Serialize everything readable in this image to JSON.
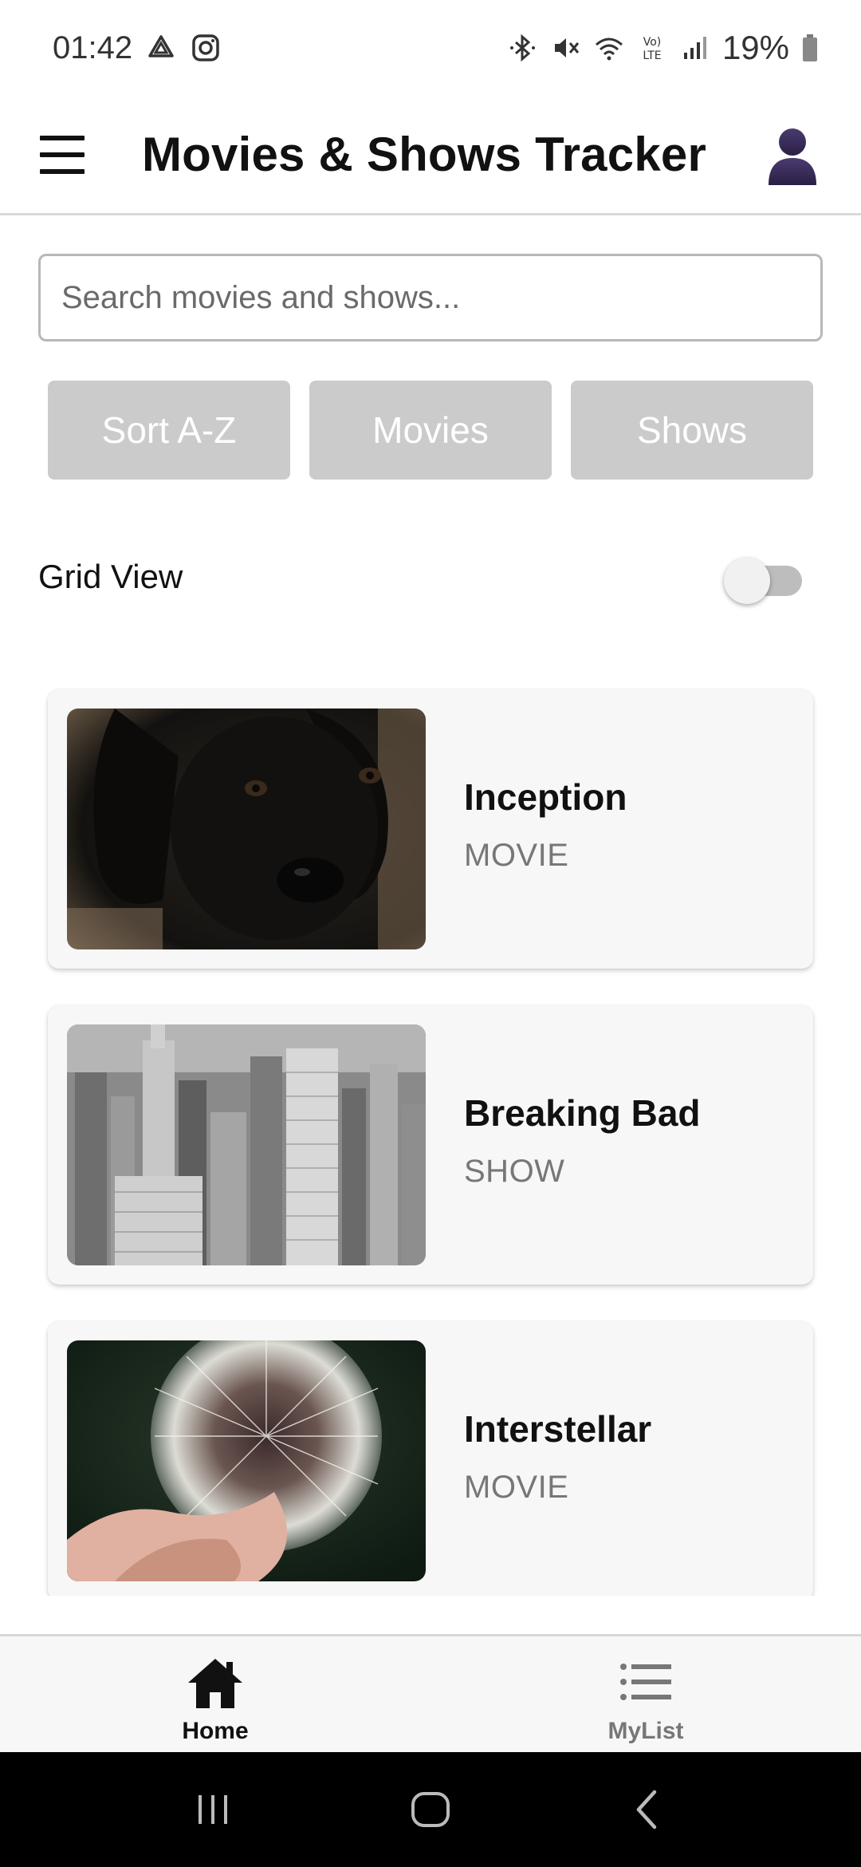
{
  "status_bar": {
    "time": "01:42",
    "battery": "19%",
    "icons": [
      "drive-icon",
      "instagram-icon",
      "bluetooth-icon",
      "mute-icon",
      "wifi-icon",
      "volte-icon",
      "signal-icon",
      "battery-icon"
    ]
  },
  "header": {
    "title": "Movies & Shows Tracker",
    "menu_icon": "hamburger-menu-icon",
    "profile_icon": "user-avatar-icon"
  },
  "search": {
    "placeholder": "Search movies and shows...",
    "value": ""
  },
  "filters": [
    {
      "label": "Sort A-Z"
    },
    {
      "label": "Movies"
    },
    {
      "label": "Shows"
    }
  ],
  "grid_view": {
    "label": "Grid View",
    "enabled": false
  },
  "items": [
    {
      "title": "Inception",
      "type": "MOVIE",
      "image": "black-puppy-photo"
    },
    {
      "title": "Breaking Bad",
      "type": "SHOW",
      "image": "city-skyline-photo"
    },
    {
      "title": "Interstellar",
      "type": "MOVIE",
      "image": "dandelion-photo"
    }
  ],
  "bottom_nav": [
    {
      "label": "Home",
      "icon": "home-icon",
      "active": true
    },
    {
      "label": "MyList",
      "icon": "list-icon",
      "active": false
    }
  ],
  "colors": {
    "filter_button_bg": "#cbcbcb",
    "avatar": "#3b2d5c",
    "type_text": "#777777"
  }
}
